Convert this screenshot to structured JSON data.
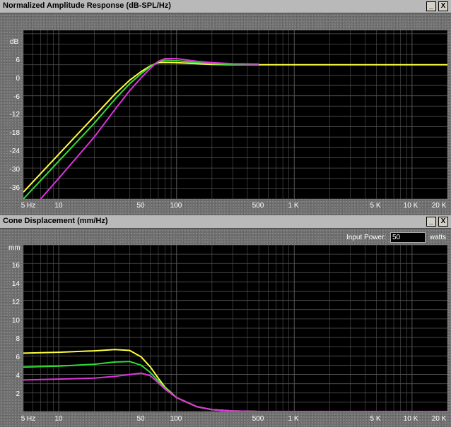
{
  "panels": [
    {
      "title": "Normalized Amplitude Response (dB-SPL/Hz)",
      "y_unit": "dB",
      "y_ticks": [
        "6",
        "0",
        "-6",
        "-12",
        "-18",
        "-24",
        "-30",
        "-36"
      ],
      "x_ticks": [
        "5 Hz",
        "10",
        "50",
        "100",
        "500",
        "1 K",
        "5 K",
        "10 K",
        "20 K"
      ]
    },
    {
      "title": "Cone Displacement (mm/Hz)",
      "y_unit": "mm",
      "y_ticks": [
        "16",
        "14",
        "12",
        "10",
        "8",
        "6",
        "4",
        "2"
      ],
      "x_ticks": [
        "5 Hz",
        "10",
        "50",
        "100",
        "500",
        "1 K",
        "5 K",
        "10 K",
        "20 K"
      ],
      "input_power_label": "Input Power:",
      "input_power_value": "50",
      "input_power_unit": "watts"
    }
  ],
  "window_buttons": {
    "minimize": "_",
    "close": "X"
  },
  "colors": {
    "curve1": "#ffff40",
    "curve2": "#33dd33",
    "curve3": "#dd33dd",
    "grid": "#555555",
    "plot_bg": "#000000"
  },
  "chart_data": [
    {
      "type": "line",
      "title": "Normalized Amplitude Response (dB-SPL/Hz)",
      "x_scale": "log",
      "xlim": [
        5,
        20000
      ],
      "ylim": [
        -39,
        10
      ],
      "series": [
        {
          "color": "#ffff40",
          "x": [
            5,
            10,
            20,
            30,
            40,
            50,
            60,
            70,
            80,
            100,
            150,
            200,
            300,
            20000
          ],
          "y": [
            -37,
            -26,
            -15,
            -8.5,
            -4.5,
            -2,
            -0.3,
            0.6,
            0.7,
            0.6,
            0.3,
            0.1,
            0,
            0
          ]
        },
        {
          "color": "#33dd33",
          "x": [
            5,
            10,
            20,
            30,
            40,
            50,
            60,
            70,
            80,
            100,
            150,
            200,
            300,
            500
          ],
          "y": [
            -39,
            -28,
            -17,
            -10,
            -5.5,
            -2.6,
            -0.5,
            0.9,
            1.3,
            1.2,
            0.6,
            0.3,
            0.1,
            0
          ]
        },
        {
          "color": "#dd33dd",
          "x": [
            7,
            10,
            20,
            30,
            40,
            50,
            60,
            70,
            80,
            100,
            150,
            200,
            300,
            500
          ],
          "y": [
            -39,
            -33,
            -21,
            -13,
            -7.5,
            -3.8,
            -1,
            1,
            1.8,
            1.8,
            1,
            0.6,
            0.3,
            0.2
          ]
        }
      ]
    },
    {
      "type": "line",
      "title": "Cone Displacement (mm/Hz)",
      "x_scale": "log",
      "xlim": [
        5,
        20000
      ],
      "ylim": [
        0,
        18
      ],
      "series": [
        {
          "color": "#ffff40",
          "x": [
            5,
            10,
            20,
            30,
            40,
            50,
            60,
            70,
            80,
            100,
            150,
            200,
            300,
            500,
            20000
          ],
          "y": [
            6.3,
            6.4,
            6.55,
            6.7,
            6.6,
            5.9,
            4.8,
            3.6,
            2.6,
            1.5,
            0.5,
            0.2,
            0.05,
            0,
            0
          ]
        },
        {
          "color": "#33dd33",
          "x": [
            5,
            10,
            20,
            30,
            40,
            50,
            60,
            70,
            80,
            100,
            150,
            200,
            300,
            500,
            20000
          ],
          "y": [
            4.8,
            4.9,
            5.1,
            5.35,
            5.4,
            5,
            4.2,
            3.3,
            2.5,
            1.5,
            0.5,
            0.2,
            0.05,
            0,
            0
          ]
        },
        {
          "color": "#dd33dd",
          "x": [
            5,
            10,
            20,
            30,
            40,
            50,
            60,
            70,
            80,
            100,
            150,
            200,
            300,
            500,
            20000
          ],
          "y": [
            3.4,
            3.5,
            3.6,
            3.8,
            4.0,
            4.15,
            3.85,
            3.1,
            2.4,
            1.5,
            0.5,
            0.2,
            0.05,
            0,
            0
          ]
        }
      ]
    }
  ]
}
